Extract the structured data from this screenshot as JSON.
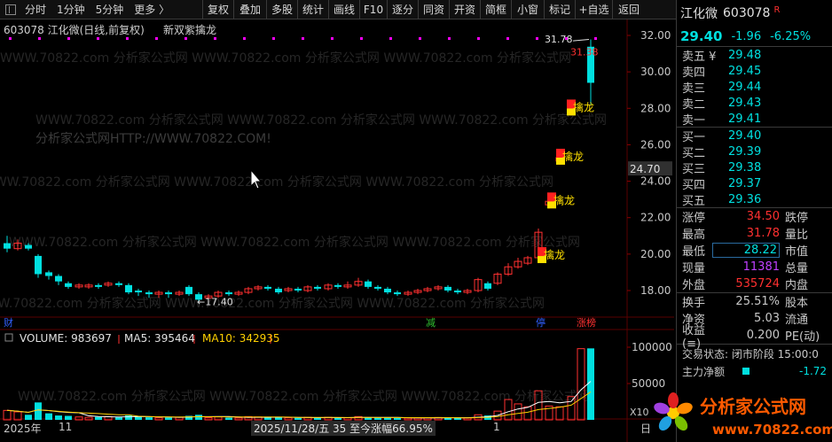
{
  "toolbar": {
    "left_items": [
      "分时",
      "1分钟",
      "5分钟",
      "更多 〉"
    ],
    "buttons": [
      "复权",
      "叠加",
      "多股",
      "统计",
      "画线",
      "F10",
      "逐分",
      "同资",
      "开资",
      "简框",
      "小窗",
      "标记",
      "+自选",
      "返回"
    ]
  },
  "chart": {
    "title_code": "603078 江化微(日线,前复权)",
    "indicator_name": "新双紫擒龙",
    "price_axis": [
      "32.00",
      "30.00",
      "28.00",
      "26.00",
      "24.00",
      "22.00",
      "20.00",
      "18.00"
    ],
    "current_price_tag": "24.70",
    "high_label": "31.78",
    "high_label_partial": "31.38",
    "low_label": "←17.40",
    "signal_label": "擒龙",
    "cursor_icon": "mouse-pointer-icon",
    "event_markers": [
      "财",
      "减",
      "停",
      "涨榜"
    ],
    "watermarks": [
      "分析家公式网HTTP://WWW.70822.COM!",
      "WWW.70822.com 分析家公式网"
    ]
  },
  "volume": {
    "label": "VOLUME: 983697",
    "ma5_label": "MA5: 395464",
    "ma10_label": "MA10: 342935",
    "axis": [
      "100000",
      "50000"
    ],
    "axis_unit": "X10"
  },
  "date_bar": {
    "year": "2025年",
    "month_11": "11",
    "month_1": "1",
    "cursor_info": "2025/11/28/五  35 至今涨幅66.95%",
    "end_tag": "日"
  },
  "quote": {
    "name": "江化微",
    "code": "603078",
    "badge": "R",
    "price": "29.40",
    "change": "-1.96",
    "pct": "-6.25%",
    "asks": [
      {
        "label": "卖五 ¥",
        "price": "29.48"
      },
      {
        "label": "卖四",
        "price": "29.45"
      },
      {
        "label": "卖三",
        "price": "29.44"
      },
      {
        "label": "卖二",
        "price": "29.43"
      },
      {
        "label": "卖一",
        "price": "29.41"
      }
    ],
    "bids": [
      {
        "label": "买一",
        "price": "29.40"
      },
      {
        "label": "买二",
        "price": "29.39"
      },
      {
        "label": "买三",
        "price": "29.38"
      },
      {
        "label": "买四",
        "price": "29.37"
      },
      {
        "label": "买五",
        "price": "29.36"
      }
    ],
    "stats1": [
      {
        "label": "涨停",
        "value": "34.50",
        "color": "#ff3030",
        "label2": "跌停"
      },
      {
        "label": "最高",
        "value": "31.78",
        "color": "#ff3030",
        "label2": "量比"
      },
      {
        "label": "最低",
        "value": "28.22",
        "color": "#00e0e0",
        "label2": "市值"
      },
      {
        "label": "现量",
        "value": "11381",
        "color": "#c040ff",
        "label2": "总量"
      },
      {
        "label": "外盘",
        "value": "535724",
        "color": "#ff3030",
        "label2": "内盘"
      }
    ],
    "stats2": [
      {
        "label": "换手",
        "value": "25.51%",
        "color": "#c8c8c8",
        "label2": "股本"
      },
      {
        "label": "净资",
        "value": "5.03",
        "color": "#c8c8c8",
        "label2": "流通"
      },
      {
        "label": "收益(≡)",
        "value": "0.200",
        "color": "#c8c8c8",
        "label2": "PE(动)"
      }
    ],
    "trade_status": "交易状态: 闭市阶段  15:00:0",
    "main_flow_label": "主力净额",
    "main_flow_value": "-1.72"
  },
  "logo": {
    "text": "分析家公式网",
    "url": "www.70822.com"
  },
  "colors": {
    "up": "#ff3030",
    "down": "#00e0e0",
    "ma5": "#ffffff",
    "ma10": "#ffd000",
    "signal": "#ffe000"
  }
}
